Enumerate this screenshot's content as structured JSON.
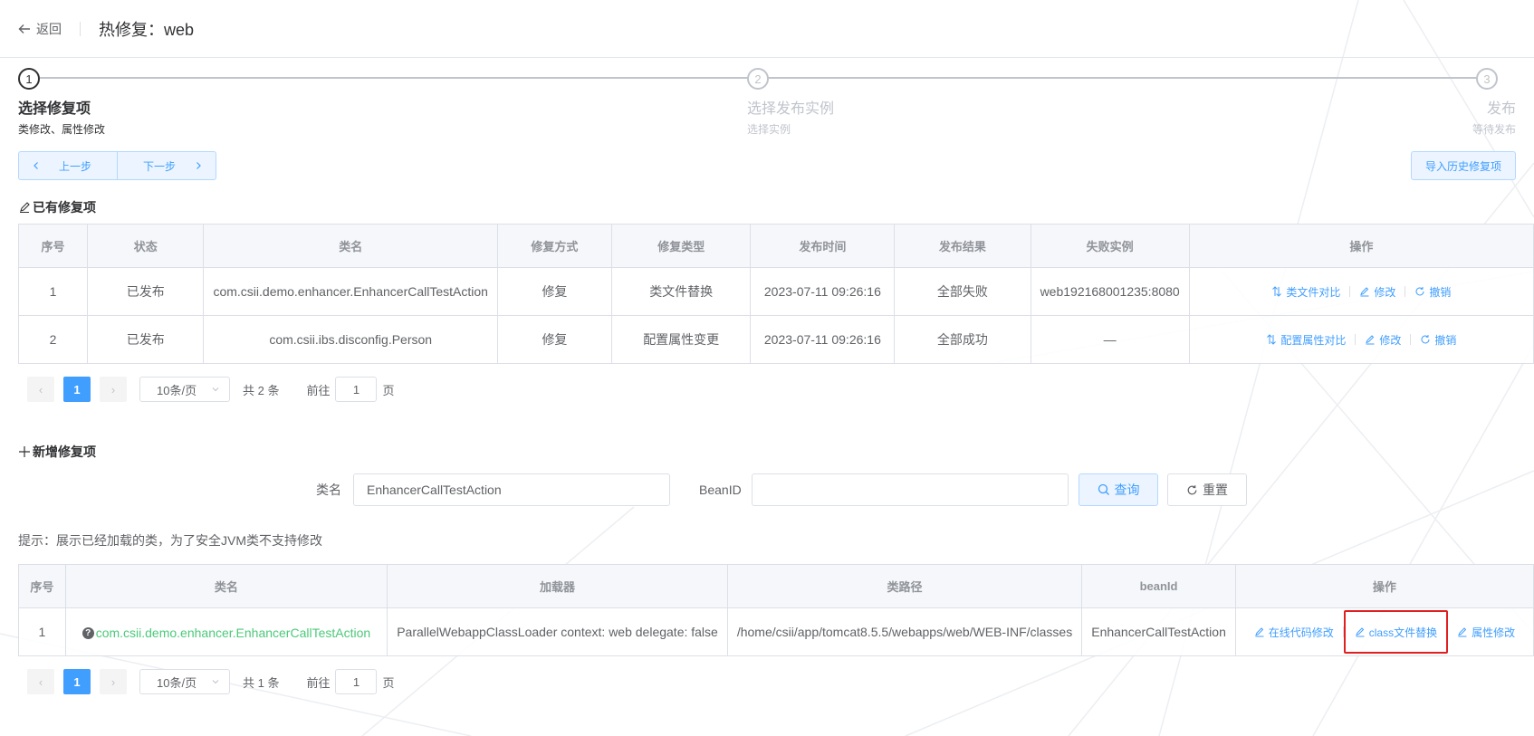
{
  "header": {
    "back_label": "返回",
    "title": "热修复：web"
  },
  "steps": [
    {
      "num": "1",
      "title": "选择修复项",
      "desc": "类修改、属性修改"
    },
    {
      "num": "2",
      "title": "选择发布实例",
      "desc": "选择实例"
    },
    {
      "num": "3",
      "title": "发布",
      "desc": "等待发布"
    }
  ],
  "toolbar": {
    "prev_label": "上一步",
    "next_label": "下一步",
    "import_label": "导入历史修复项"
  },
  "existing": {
    "title": "已有修复项",
    "columns": [
      "序号",
      "状态",
      "类名",
      "修复方式",
      "修复类型",
      "发布时间",
      "发布结果",
      "失败实例",
      "操作"
    ],
    "rows": [
      {
        "idx": "1",
        "status": "已发布",
        "class": "com.csii.demo.enhancer.EnhancerCallTestAction",
        "method": "修复",
        "type": "类文件替换",
        "time": "2023-07-11 09:26:16",
        "result": "全部失败",
        "failed": "web192168001235:8080",
        "op_compare": "类文件对比",
        "op_edit": "修改",
        "op_revoke": "撤销"
      },
      {
        "idx": "2",
        "status": "已发布",
        "class": "com.csii.ibs.disconfig.Person",
        "method": "修复",
        "type": "配置属性变更",
        "time": "2023-07-11 09:26:16",
        "result": "全部成功",
        "failed": "—",
        "op_compare": "配置属性对比",
        "op_edit": "修改",
        "op_revoke": "撤销"
      }
    ],
    "pager": {
      "page": "1",
      "size": "10条/页",
      "total": "共 2 条",
      "goto_prefix": "前往",
      "goto_value": "1",
      "goto_suffix": "页"
    }
  },
  "add": {
    "title": "新增修复项",
    "class_label": "类名",
    "class_value": "EnhancerCallTestAction",
    "beanid_label": "BeanID",
    "beanid_value": "",
    "query_label": "查询",
    "reset_label": "重置",
    "tip": "提示：展示已经加载的类，为了安全JVM类不支持修改",
    "columns": [
      "序号",
      "类名",
      "加载器",
      "类路径",
      "beanId",
      "操作"
    ],
    "rows": [
      {
        "idx": "1",
        "class": "com.csii.demo.enhancer.EnhancerCallTestAction",
        "loader": "ParallelWebappClassLoader context: web delegate: false",
        "path": "/home/csii/app/tomcat8.5.5/webapps/web/WEB-INF/classes",
        "beanid": "EnhancerCallTestAction",
        "op_online": "在线代码修改",
        "op_class": "class文件替换",
        "op_prop": "属性修改"
      }
    ],
    "pager": {
      "page": "1",
      "size": "10条/页",
      "total": "共 1 条",
      "goto_prefix": "前往",
      "goto_value": "1",
      "goto_suffix": "页"
    }
  },
  "colors": {
    "primary": "#409eff",
    "success_text": "#4cc97a",
    "highlight_border": "#e02020"
  }
}
